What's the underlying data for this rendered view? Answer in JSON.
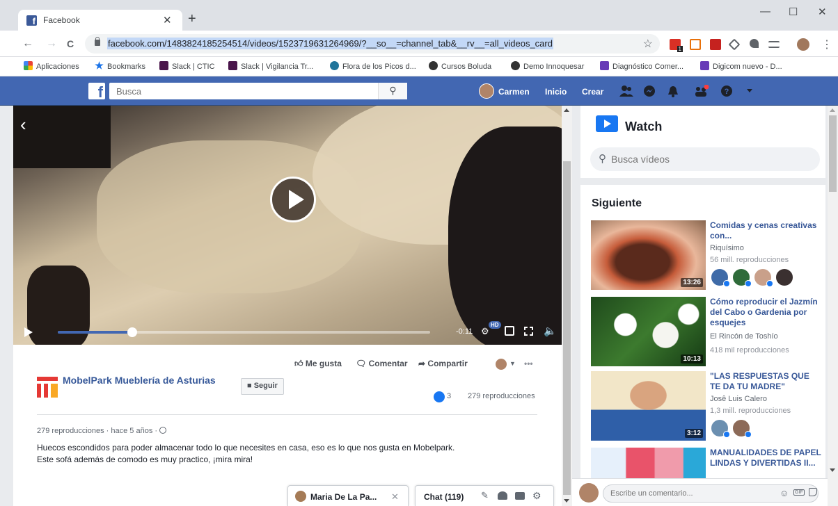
{
  "browser": {
    "tab_title": "Facebook",
    "url": "facebook.com/1483824185254514/videos/1523719631264969/?__so__=channel_tab&__rv__=all_videos_card",
    "minimize": "—",
    "maximize": "☐",
    "close": "✕",
    "new_tab": "+",
    "back": "←",
    "forward": "→",
    "reload": "C",
    "star": "☆",
    "menu": "⋮",
    "ext_badge": "1"
  },
  "bookmarks": [
    {
      "label": "Aplicaciones",
      "color": "#ea4335"
    },
    {
      "label": "Bookmarks",
      "color": "#1a73e8"
    },
    {
      "label": "Slack | CTIC",
      "color": "#4a154b"
    },
    {
      "label": "Slack | Vigilancia Tr...",
      "color": "#4a154b"
    },
    {
      "label": "Flora de los Picos d...",
      "color": "#21759b"
    },
    {
      "label": "Cursos Boluda",
      "color": "#333333"
    },
    {
      "label": "Demo Innoquesar",
      "color": "#333333"
    },
    {
      "label": "Diagnóstico Comer...",
      "color": "#673ab7"
    },
    {
      "label": "Digicom nuevo - D...",
      "color": "#673ab7"
    }
  ],
  "fb_header": {
    "search_placeholder": "Busca",
    "user": "Carmen",
    "home": "Inicio",
    "create": "Crear"
  },
  "video": {
    "time_remaining": "-0:11",
    "progress_fraction": 0.2,
    "hd": "HD"
  },
  "post": {
    "like": "Me gusta",
    "comment": "Comentar",
    "share": "Compartir",
    "more": "•••",
    "page_name": "MobelPark Mueblería de Asturias",
    "follow": "Seguir",
    "like_count": "3",
    "views_right": "279 reproducciones",
    "meta": "279 reproducciones · hace 5 años ·",
    "description_line1": "Huecos escondidos para poder almacenar todo lo que necesites en casa, eso es lo que nos gusta en Mobelpark.",
    "description_line2": "Este sofá además de comodo es muy practico, ¡mira mira!"
  },
  "chat": {
    "person": "Maria De La Pa...",
    "close": "✕",
    "main": "Chat (119)"
  },
  "sidebar": {
    "watch_title": "Watch",
    "search_placeholder": "Busca vídeos",
    "next_title": "Siguiente",
    "videos": [
      {
        "title": "Comidas y cenas creativas con...",
        "channel": "Riquísimo",
        "views": "56 mill. reproducciones",
        "duration": "13:26"
      },
      {
        "title": "Cómo reproducir el Jazmín del Cabo o Gardenia por esquejes",
        "channel": "El Rincón de Toshío",
        "views": "418 mil reproducciones",
        "duration": "10:13"
      },
      {
        "title": "\"LAS RESPUESTAS QUE TE DA TU MADRE\"",
        "channel": "Josê Luis Calero",
        "views": "1,3 mill. reproducciones",
        "duration": "3:12"
      },
      {
        "title": "MANUALIDADES DE PAPEL LINDAS Y DIVERTIDAS II...",
        "channel": "",
        "views": "",
        "duration": ""
      }
    ],
    "comment_placeholder": "Escribe un comentario..."
  }
}
